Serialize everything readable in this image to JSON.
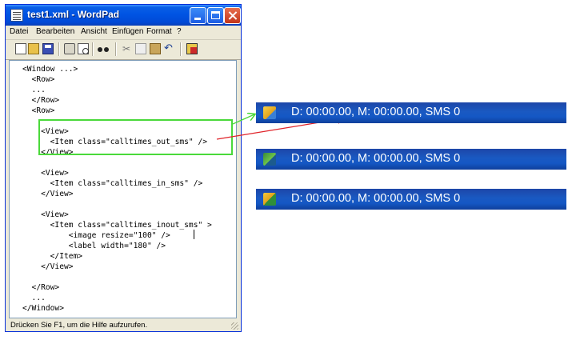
{
  "window": {
    "title": "test1.xml - WordPad",
    "menu": [
      "Datei",
      "Bearbeiten",
      "Ansicht",
      "Einfügen",
      "Format",
      "?"
    ],
    "toolbar_icons": [
      "new-icon",
      "open-icon",
      "save-icon",
      "print-icon",
      "print-preview-icon",
      "find-icon",
      "cut-icon",
      "copy-icon",
      "paste-icon",
      "undo-icon",
      "insert-object-icon"
    ],
    "status": "Drücken Sie F1, um die Hilfe aufzurufen."
  },
  "document": {
    "lines": [
      "<Window ...>",
      "  <Row>",
      "  ...",
      "  </Row>",
      "  <Row>",
      "",
      "    <View>",
      "      <Item class=\"calltimes_out_sms\" />",
      "    </View>",
      "",
      "    <View>",
      "      <Item class=\"calltimes_in_sms\" />",
      "    </View>",
      "",
      "    <View>",
      "      <Item class=\"calltimes_inout_sms\" >",
      "          <image resize=\"100\" />",
      "          <label width=\"180\" />",
      "      </Item>",
      "    </View>",
      "",
      "  </Row>",
      "  ...",
      "</Window>"
    ]
  },
  "previews": [
    {
      "icon": "outgoing-sms-icon",
      "text": "D: 00:00.00, M: 00:00.00, SMS 0"
    },
    {
      "icon": "incoming-sms-icon",
      "text": "D: 00:00.00, M: 00:00.00, SMS 0"
    },
    {
      "icon": "inout-sms-icon",
      "text": "D: 00:00.00, M: 00:00.00, SMS 0"
    }
  ],
  "colors": {
    "highlight": "#4ad93a",
    "arrow_green": "#4ad93a",
    "arrow_red": "#e0242a",
    "row_blue": "#1a59c2"
  }
}
